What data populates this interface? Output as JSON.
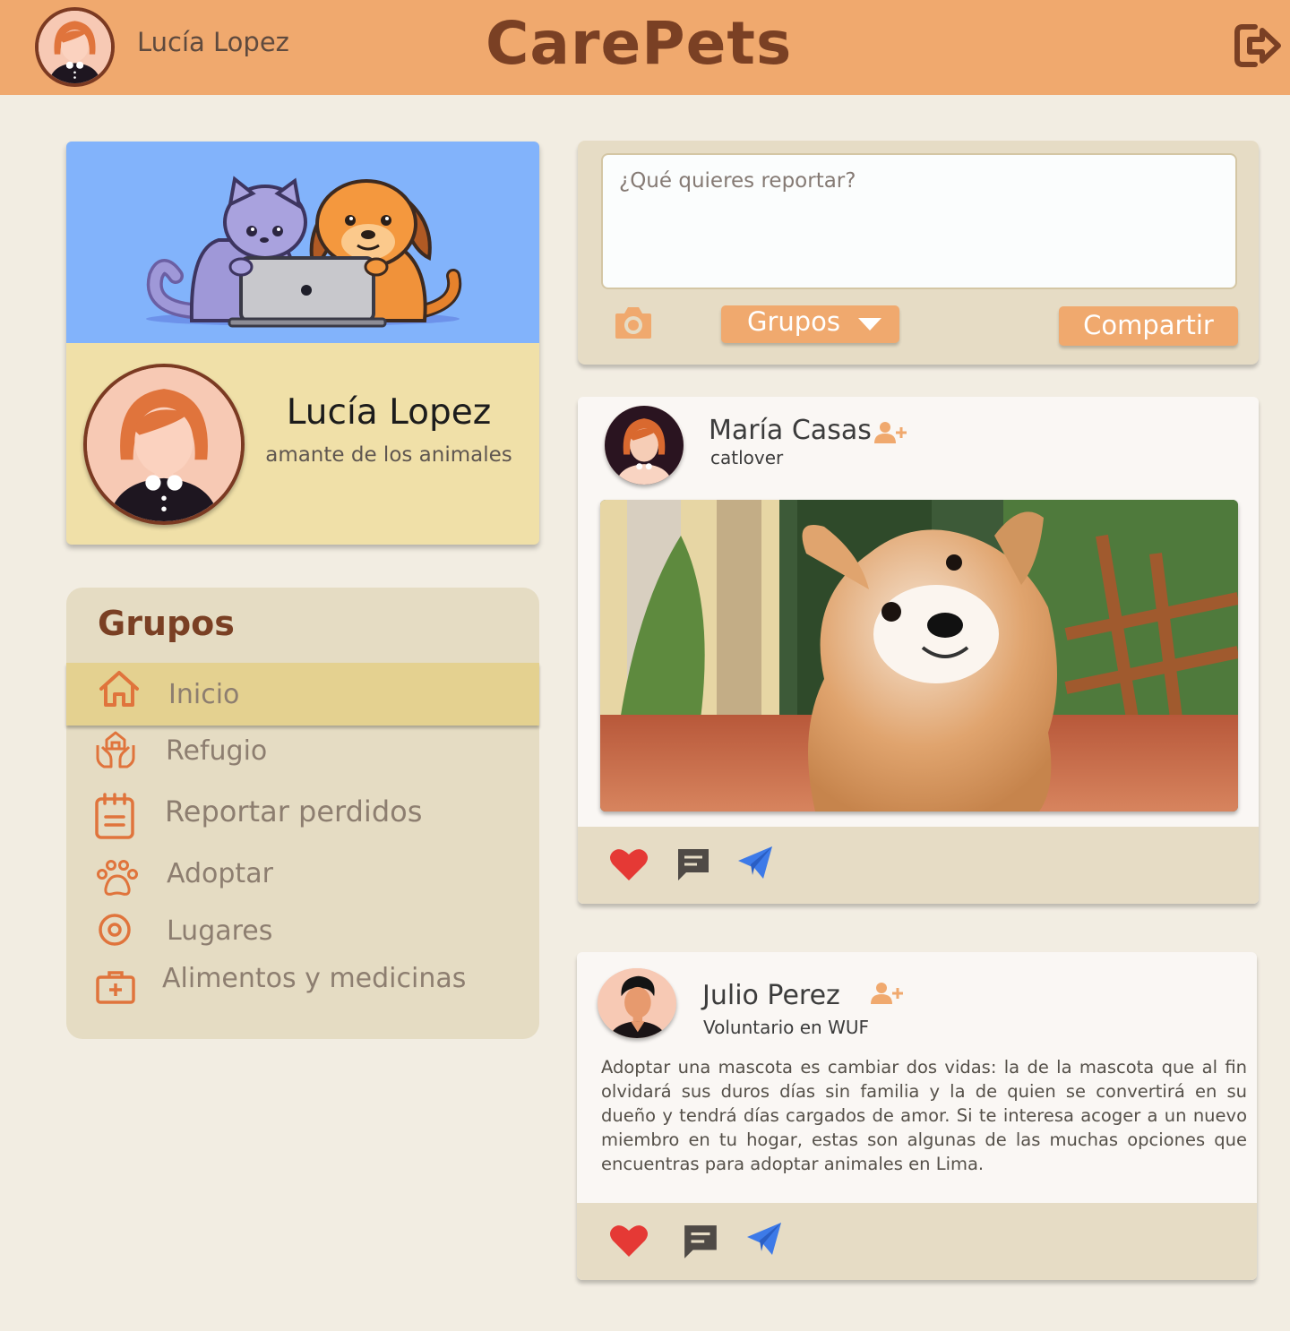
{
  "header": {
    "user_name": "Lucía Lopez",
    "brand": "CarePets",
    "logout_icon": "logout-icon",
    "bg_color": "#f0a96e"
  },
  "profile": {
    "name": "Lucía Lopez",
    "bio": "amante de los animales",
    "banner_color": "#82b3fb",
    "card_color": "#f0e0a8"
  },
  "groups": {
    "title": "Grupos",
    "items": [
      {
        "label": "Inicio",
        "icon": "home-icon",
        "active": true
      },
      {
        "label": "Refugio",
        "icon": "shelter-icon",
        "active": false
      },
      {
        "label": "Reportar perdidos",
        "icon": "report-icon",
        "active": false
      },
      {
        "label": "Adoptar",
        "icon": "paw-icon",
        "active": false
      },
      {
        "label": "Lugares",
        "icon": "location-icon",
        "active": false
      },
      {
        "label": "Alimentos y medicinas",
        "icon": "medkit-icon",
        "active": false
      }
    ]
  },
  "composer": {
    "placeholder": "¿Qué quieres reportar?",
    "groups_label": "Grupos",
    "share_label": "Compartir",
    "camera_icon": "camera-icon"
  },
  "posts": [
    {
      "author": "María Casas",
      "subtitle": "catlover",
      "image": "corgi puppy photo",
      "actions": [
        "heart-icon",
        "comment-icon",
        "send-icon"
      ]
    },
    {
      "author": "Julio Perez",
      "subtitle": "Voluntario en WUF",
      "body": "Adoptar una mascota es cambiar dos vidas: la de la mascota que al fin olvidará sus duros días sin familia y la de quien se convertirá en su dueño y tendrá días cargados de amor. Si te interesa acoger a un nuevo miembro en tu hogar, estas son algunas de las muchas opciones que encuentras para adoptar animales en Lima.",
      "actions": [
        "heart-icon",
        "comment-icon",
        "send-icon"
      ]
    }
  ],
  "colors": {
    "accent": "#f0a96e",
    "brown": "#7a4024",
    "page_bg": "#f2ede2",
    "panel": "#e6dcc5",
    "heart": "#e53935",
    "send": "#3d7ae8"
  }
}
